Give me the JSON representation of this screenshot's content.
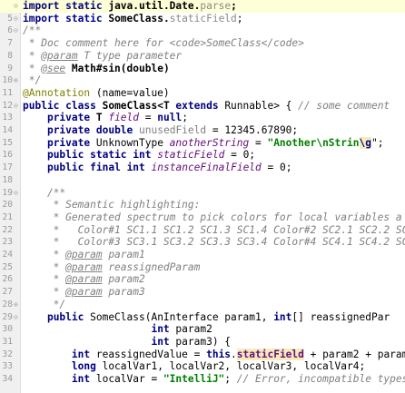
{
  "lines": [
    {
      "num": "",
      "fold": "⊖",
      "tokens": [
        {
          "t": "import",
          "c": "kw"
        },
        {
          "t": " ",
          "c": ""
        },
        {
          "t": "static",
          "c": "kw"
        },
        {
          "t": " java.util.Date.",
          "c": "bold"
        },
        {
          "t": "parse",
          "c": "dim"
        },
        {
          "t": ";",
          "c": "bold"
        }
      ]
    },
    {
      "num": "5",
      "fold": "⊖",
      "tokens": [
        {
          "t": "import",
          "c": "kw"
        },
        {
          "t": " ",
          "c": ""
        },
        {
          "t": "static",
          "c": "kw"
        },
        {
          "t": " SomeClass.",
          "c": "bold"
        },
        {
          "t": "staticField",
          "c": "dim"
        },
        {
          "t": ";",
          "c": ""
        }
      ]
    },
    {
      "num": "6",
      "fold": "⊖",
      "tokens": [
        {
          "t": "/**",
          "c": "doc"
        }
      ]
    },
    {
      "num": "7",
      "fold": "",
      "tokens": [
        {
          "t": " * Doc comment here for <code>SomeClass</code>",
          "c": "doc"
        }
      ]
    },
    {
      "num": "8",
      "fold": "",
      "tokens": [
        {
          "t": " * ",
          "c": "doc"
        },
        {
          "t": "@param",
          "c": "tag"
        },
        {
          "t": " T type parameter",
          "c": "doc"
        }
      ]
    },
    {
      "num": "9",
      "fold": "",
      "tokens": [
        {
          "t": " * ",
          "c": "doc"
        },
        {
          "t": "@see",
          "c": "tag"
        },
        {
          "t": " Math#sin(double)",
          "c": "bold"
        }
      ]
    },
    {
      "num": "10",
      "fold": "⊕",
      "tokens": [
        {
          "t": " */",
          "c": "doc"
        }
      ]
    },
    {
      "num": "11",
      "fold": "",
      "tokens": [
        {
          "t": "@Annotation",
          "c": "ann"
        },
        {
          "t": " (name=value)",
          "c": ""
        }
      ]
    },
    {
      "num": "12",
      "fold": "⊖",
      "tokens": [
        {
          "t": "public",
          "c": "kw"
        },
        {
          "t": " ",
          "c": ""
        },
        {
          "t": "class",
          "c": "kw"
        },
        {
          "t": " SomeClass<T ",
          "c": "bold"
        },
        {
          "t": "extends",
          "c": "kw"
        },
        {
          "t": " Runnable> { ",
          "c": ""
        },
        {
          "t": "// some comment",
          "c": "cm"
        }
      ]
    },
    {
      "num": "13",
      "fold": "",
      "tokens": [
        {
          "t": "    ",
          "c": ""
        },
        {
          "t": "private",
          "c": "kw"
        },
        {
          "t": " T ",
          "c": "bold"
        },
        {
          "t": "field",
          "c": "fieldi"
        },
        {
          "t": " = ",
          "c": ""
        },
        {
          "t": "null",
          "c": "kw"
        },
        {
          "t": ";",
          "c": ""
        }
      ]
    },
    {
      "num": "14",
      "fold": "",
      "tokens": [
        {
          "t": "    ",
          "c": ""
        },
        {
          "t": "private",
          "c": "kw"
        },
        {
          "t": " ",
          "c": ""
        },
        {
          "t": "double",
          "c": "kw"
        },
        {
          "t": " ",
          "c": ""
        },
        {
          "t": "unusedField",
          "c": "unused"
        },
        {
          "t": " = 12345.67890;",
          "c": ""
        }
      ]
    },
    {
      "num": "15",
      "fold": "",
      "tokens": [
        {
          "t": "    ",
          "c": ""
        },
        {
          "t": "private",
          "c": "kw"
        },
        {
          "t": " UnknownType ",
          "c": ""
        },
        {
          "t": "anotherString",
          "c": "fieldi"
        },
        {
          "t": " = ",
          "c": ""
        },
        {
          "t": "\"Another\\nStrin",
          "c": "str"
        },
        {
          "t": "\\g",
          "c": "esc warn"
        },
        {
          "t": "\";",
          "c": ""
        }
      ]
    },
    {
      "num": "16",
      "fold": "",
      "tokens": [
        {
          "t": "    ",
          "c": ""
        },
        {
          "t": "public",
          "c": "kw"
        },
        {
          "t": " ",
          "c": ""
        },
        {
          "t": "static",
          "c": "kw"
        },
        {
          "t": " ",
          "c": ""
        },
        {
          "t": "int",
          "c": "kw"
        },
        {
          "t": " ",
          "c": ""
        },
        {
          "t": "staticField",
          "c": "fieldi"
        },
        {
          "t": " = 0;",
          "c": ""
        }
      ]
    },
    {
      "num": "17",
      "fold": "",
      "tokens": [
        {
          "t": "    ",
          "c": ""
        },
        {
          "t": "public",
          "c": "kw"
        },
        {
          "t": " ",
          "c": ""
        },
        {
          "t": "final",
          "c": "kw"
        },
        {
          "t": " ",
          "c": ""
        },
        {
          "t": "int",
          "c": "kw"
        },
        {
          "t": " ",
          "c": ""
        },
        {
          "t": "instanceFinalField",
          "c": "fieldi"
        },
        {
          "t": " = 0;",
          "c": ""
        }
      ]
    },
    {
      "num": "18",
      "fold": "",
      "tokens": []
    },
    {
      "num": "19",
      "fold": "⊖",
      "tokens": [
        {
          "t": "    /**",
          "c": "doc"
        }
      ]
    },
    {
      "num": "20",
      "fold": "",
      "tokens": [
        {
          "t": "     * Semantic highlighting:",
          "c": "doc"
        }
      ]
    },
    {
      "num": "21",
      "fold": "",
      "tokens": [
        {
          "t": "     * Generated spectrum to pick colors for local variables a",
          "c": "doc"
        }
      ]
    },
    {
      "num": "22",
      "fold": "",
      "tokens": [
        {
          "t": "     *   Color#1 SC1.1 SC1.2 SC1.3 SC1.4 Color#2 SC2.1 SC2.2 SC",
          "c": "doc"
        }
      ]
    },
    {
      "num": "23",
      "fold": "",
      "tokens": [
        {
          "t": "     *   Color#3 SC3.1 SC3.2 SC3.3 SC3.4 Color#4 SC4.1 SC4.2 SC",
          "c": "doc"
        }
      ]
    },
    {
      "num": "24",
      "fold": "",
      "tokens": [
        {
          "t": "     * ",
          "c": "doc"
        },
        {
          "t": "@param",
          "c": "tag"
        },
        {
          "t": " param1",
          "c": "doc"
        }
      ]
    },
    {
      "num": "25",
      "fold": "",
      "tokens": [
        {
          "t": "     * ",
          "c": "doc"
        },
        {
          "t": "@param",
          "c": "tag"
        },
        {
          "t": " reassignedParam",
          "c": "doc"
        }
      ]
    },
    {
      "num": "26",
      "fold": "",
      "tokens": [
        {
          "t": "     * ",
          "c": "doc"
        },
        {
          "t": "@param",
          "c": "tag"
        },
        {
          "t": " param2",
          "c": "doc"
        }
      ]
    },
    {
      "num": "27",
      "fold": "",
      "tokens": [
        {
          "t": "     * ",
          "c": "doc"
        },
        {
          "t": "@param",
          "c": "tag"
        },
        {
          "t": " param3",
          "c": "doc"
        }
      ]
    },
    {
      "num": "28",
      "fold": "⊕",
      "tokens": [
        {
          "t": "     */",
          "c": "doc"
        }
      ]
    },
    {
      "num": "29",
      "fold": "⊖",
      "tokens": [
        {
          "t": "    ",
          "c": ""
        },
        {
          "t": "public",
          "c": "kw"
        },
        {
          "t": " SomeClass(AnInterface param1, ",
          "c": ""
        },
        {
          "t": "int",
          "c": "kw"
        },
        {
          "t": "[] reassignedPar",
          "c": ""
        }
      ]
    },
    {
      "num": "30",
      "fold": "",
      "tokens": [
        {
          "t": "                     ",
          "c": ""
        },
        {
          "t": "int",
          "c": "kw"
        },
        {
          "t": " param2",
          "c": ""
        }
      ]
    },
    {
      "num": "31",
      "fold": "",
      "tokens": [
        {
          "t": "                     ",
          "c": ""
        },
        {
          "t": "int",
          "c": "kw"
        },
        {
          "t": " param3) {",
          "c": ""
        }
      ]
    },
    {
      "num": "32",
      "fold": "",
      "tokens": [
        {
          "t": "        ",
          "c": ""
        },
        {
          "t": "int",
          "c": "kw"
        },
        {
          "t": " reassignedValue = ",
          "c": ""
        },
        {
          "t": "this",
          "c": "kw"
        },
        {
          "t": ".",
          "c": ""
        },
        {
          "t": "staticField",
          "c": "field warn"
        },
        {
          "t": " + param2 + param3",
          "c": ""
        }
      ]
    },
    {
      "num": "33",
      "fold": "",
      "tokens": [
        {
          "t": "        ",
          "c": ""
        },
        {
          "t": "long",
          "c": "kw"
        },
        {
          "t": " localVar1, localVar2, localVar3, localVar4;",
          "c": ""
        }
      ]
    },
    {
      "num": "34",
      "fold": "",
      "tokens": [
        {
          "t": "        ",
          "c": ""
        },
        {
          "t": "int",
          "c": "kw"
        },
        {
          "t": " localVar = ",
          "c": ""
        },
        {
          "t": "\"IntelliJ\"",
          "c": "str"
        },
        {
          "t": "; ",
          "c": ""
        },
        {
          "t": "// Error, incompatible types",
          "c": "cm"
        }
      ]
    }
  ]
}
